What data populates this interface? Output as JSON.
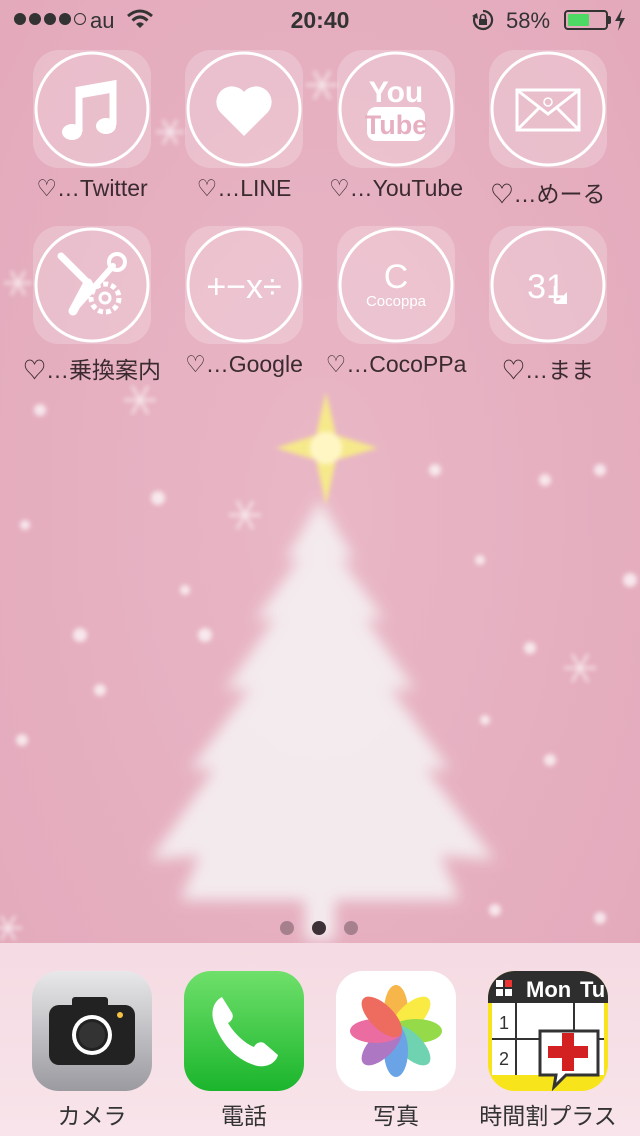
{
  "status_bar": {
    "carrier": "au",
    "time": "20:40",
    "battery_percent": "58%",
    "battery_level": 0.58,
    "signal_bars": 4,
    "signal_max": 5
  },
  "home_page": {
    "apps": [
      {
        "label": "♡…Twitter",
        "icon": "music-note-icon"
      },
      {
        "label": "♡…LINE",
        "icon": "heart-icon"
      },
      {
        "label": "♡…YouTube",
        "icon": "youtube-icon",
        "icon_text_1": "You",
        "icon_text_2": "Tube"
      },
      {
        "label": "♡…めーる",
        "icon": "envelope-icon"
      },
      {
        "label": "♡…乗換案内",
        "icon": "tools-icon"
      },
      {
        "label": "♡…Google",
        "icon": "calculator-symbols-icon",
        "icon_text": "+−x÷"
      },
      {
        "label": "♡…CocoPPa",
        "icon": "cocoppa-icon",
        "icon_text_1": "C",
        "icon_text_2": "Cocoppa"
      },
      {
        "label": "♡…まま",
        "icon": "calendar-31-icon",
        "icon_text": "31"
      }
    ],
    "page_count": 3,
    "current_page": 2
  },
  "dock": {
    "apps": [
      {
        "label": "カメラ",
        "icon": "camera-icon"
      },
      {
        "label": "電話",
        "icon": "phone-icon"
      },
      {
        "label": "写真",
        "icon": "photos-icon"
      },
      {
        "label": "時間割プラス",
        "icon": "timetable-icon",
        "icon_text_1": "Mon",
        "icon_text_2": "Tu",
        "icon_text_3": "1",
        "icon_text_4": "2"
      }
    ]
  },
  "colors": {
    "wallpaper": "#e7b0c1",
    "icon_line": "#ffffff",
    "phone_green": "#4cd964"
  }
}
